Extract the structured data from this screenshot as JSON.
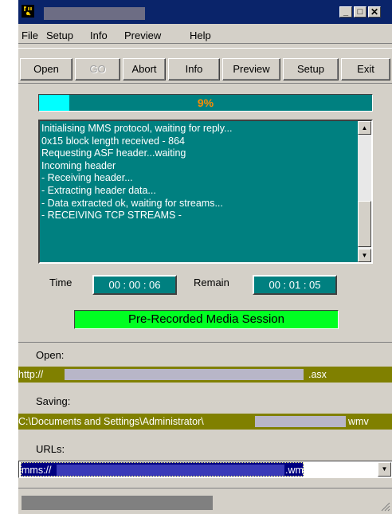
{
  "menu": [
    "File",
    "Setup",
    "Info",
    "Preview",
    "Help"
  ],
  "toolbar": {
    "open": "Open",
    "go": "GO",
    "abort": "Abort",
    "info": "Info",
    "preview": "Preview",
    "setup": "Setup",
    "exit": "Exit"
  },
  "progress": {
    "text": "9%",
    "value": 0.09
  },
  "log": [
    "Initialising MMS protocol, waiting for reply...",
    "0x15 block length received - 864",
    "Requesting ASF header...waiting",
    "Incoming header",
    "- Receiving header...",
    "- Extracting header data...",
    "- Data extracted ok, waiting for streams...",
    "- RECEIVING TCP STREAMS -"
  ],
  "time": {
    "label": "Time",
    "value": "00 : 00 : 06"
  },
  "remain": {
    "label": "Remain",
    "value": "00 : 01 : 05"
  },
  "session": "Pre-Recorded Media Session",
  "open": {
    "label": "Open:",
    "prefix": "http://",
    "suffix": ".asx"
  },
  "saving": {
    "label": "Saving:",
    "prefix": "C:\\Documents and Settings\\Administrator\\",
    "suffix": "wmv"
  },
  "urls": {
    "label": "URLs:",
    "prefix": "mms://",
    "suffix": ".wmv"
  },
  "colors": {
    "title": "#0a246a",
    "teal": "#008080",
    "olive": "#808000",
    "session": "#00ff22",
    "progress_fill": "#00ffff",
    "progress_text": "#ff8c00"
  }
}
